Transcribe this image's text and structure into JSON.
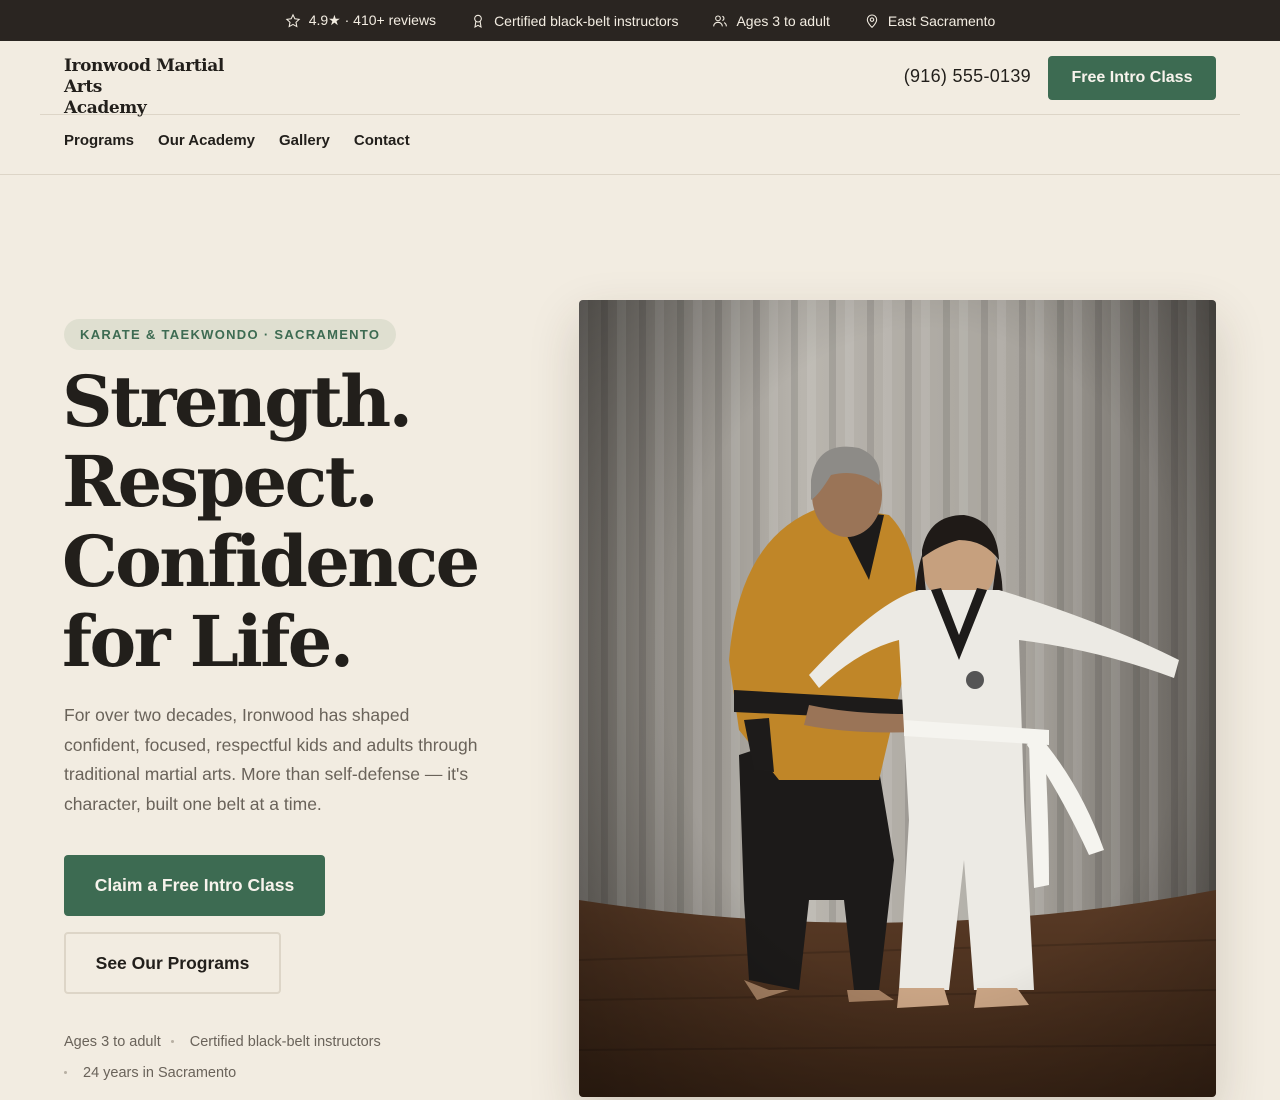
{
  "topbar": {
    "rating": "4.9★ · 410+ reviews",
    "instructors": "Certified black-belt instructors",
    "ages": "Ages 3 to adult",
    "location": "East Sacramento"
  },
  "header": {
    "logo_line1": "Ironwood Martial Arts",
    "logo_line2": "Academy",
    "phone": "(916) 555-0139",
    "cta": "Free Intro Class"
  },
  "nav": {
    "items": [
      "Programs",
      "Our Academy",
      "Gallery",
      "Contact"
    ]
  },
  "hero": {
    "eyebrow": "KARATE & TAEKWONDO · SACRAMENTO",
    "headline": [
      "Strength.",
      "Respect.",
      "Confidence",
      "for Life."
    ],
    "lede": "For over two decades, Ironwood has shaped confident, focused, respectful kids and adults through traditional martial arts. More than self-defense — it's character, built one belt at a time.",
    "primary_cta": "Claim a Free Intro Class",
    "secondary_cta": "See Our Programs",
    "facts": [
      "Ages 3 to adult",
      "Certified black-belt instructors",
      "24 years in Sacramento"
    ]
  },
  "icons": {
    "rating": "star-icon",
    "instructors": "award-ribbon-icon",
    "ages": "users-icon",
    "location": "map-pin-icon"
  },
  "colors": {
    "brand_green": "#3d6b52",
    "top_bar": "#2a2521",
    "page_background": "#f2ece1",
    "ink": "#221f1b"
  }
}
